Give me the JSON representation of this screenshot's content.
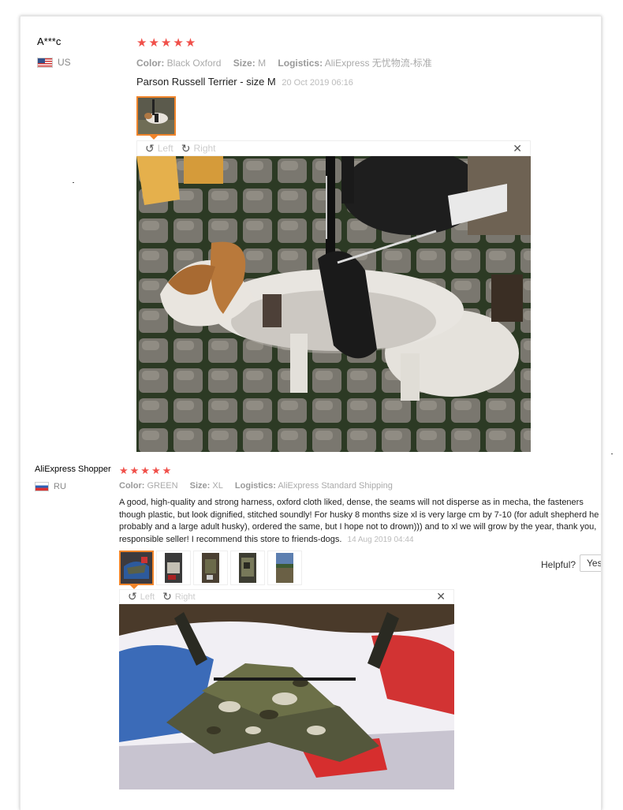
{
  "review1": {
    "name": "A***c",
    "country": "US",
    "stars": "★★★★★",
    "color_label": "Color:",
    "color_value": "Black Oxford",
    "size_label": "Size:",
    "size_value": "M",
    "logistics_label": "Logistics:",
    "logistics_value": "AliExpress 无忧物流-标准",
    "text": "Parson Russell Terrier - size M",
    "date": "20 Oct 2019 06:16",
    "viewer": {
      "left_label": "Left",
      "right_label": "Right"
    }
  },
  "review2": {
    "name": "AliExpress Shopper",
    "country": "RU",
    "stars": "★★★★★",
    "color_label": "Color:",
    "color_value": "GREEN",
    "size_label": "Size:",
    "size_value": "XL",
    "logistics_label": "Logistics:",
    "logistics_value": "AliExpress Standard Shipping",
    "text": "A good, high-quality and strong harness, oxford cloth liked, dense, the seams will not disperse as in mecha, the fasteners though plastic, but look dignified, stitched soundly! For husky 8 months size xl is very large cm by 7-10 (for adult shepherd he probably and a large adult husky), ordered the same, but I hope not to drown))) and to xl we will grow by the year, thank you, responsible seller! I recommend this store to friends-dogs.",
    "date": "14 Aug 2019 04:44",
    "helpful_label": "Helpful?",
    "yes_label": "Yes",
    "viewer": {
      "left_label": "Left",
      "right_label": "Right"
    }
  },
  "icons": {
    "star": "star-icon",
    "rotate_left": "rotate-left-icon",
    "rotate_right": "rotate-right-icon",
    "close": "close-icon"
  },
  "colors": {
    "star": "#f0504a",
    "selected_thumb": "#f0842a"
  }
}
